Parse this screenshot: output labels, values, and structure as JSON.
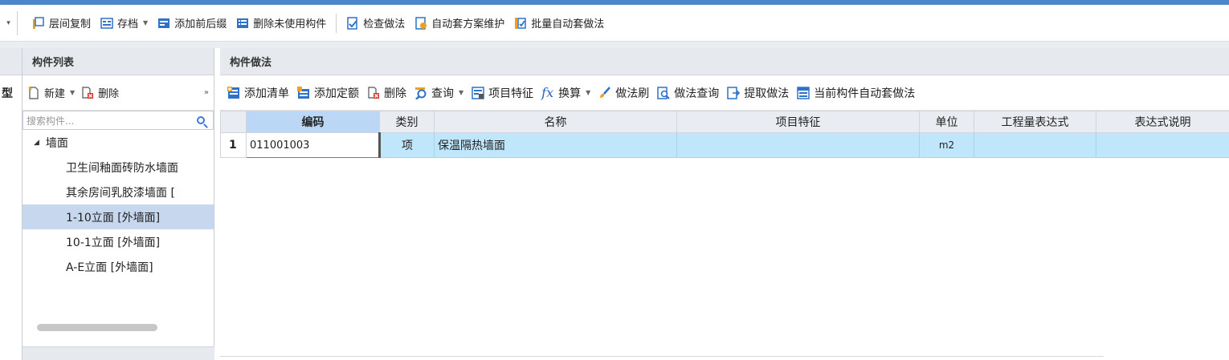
{
  "toolbar": {
    "items": [
      {
        "label": "层间复制",
        "icon": "copy-layers-icon",
        "caret": false
      },
      {
        "label": "存档",
        "icon": "save-archive-icon",
        "caret": true
      },
      {
        "label": "添加前后缀",
        "icon": "add-prefix-suffix-icon",
        "caret": false
      },
      {
        "label": "删除未使用构件",
        "icon": "delete-unused-icon",
        "caret": false
      },
      {
        "label": "检查做法",
        "icon": "check-method-icon",
        "caret": false
      },
      {
        "label": "自动套方案维护",
        "icon": "auto-scheme-icon",
        "caret": false
      },
      {
        "label": "批量自动套做法",
        "icon": "batch-auto-icon",
        "caret": false
      }
    ]
  },
  "left_edge": {
    "char": "型"
  },
  "component_list": {
    "title": "构件列表",
    "new_label": "新建",
    "delete_label": "删除",
    "search_placeholder": "搜索构件...",
    "tree": {
      "root_label": "墙面",
      "children": [
        {
          "label": "卫生间釉面砖防水墙面"
        },
        {
          "label": "其余房间乳胶漆墙面 ["
        },
        {
          "label": "1-10立面 [外墙面]",
          "selected": true
        },
        {
          "label": "10-1立面 [外墙面]"
        },
        {
          "label": "A-E立面 [外墙面]"
        }
      ]
    }
  },
  "method_panel": {
    "title": "构件做法",
    "toolbar": {
      "add_list": "添加清单",
      "add_quota": "添加定额",
      "delete": "删除",
      "query": "查询",
      "item_feature": "项目特征",
      "convert": "换算",
      "method_brush": "做法刷",
      "method_query": "做法查询",
      "extract_method": "提取做法",
      "auto_apply": "当前构件自动套做法"
    },
    "table": {
      "columns": [
        "编码",
        "类别",
        "名称",
        "项目特征",
        "单位",
        "工程量表达式",
        "表达式说明"
      ],
      "rows": [
        {
          "index": "1",
          "code": "011001003",
          "type": "项",
          "name": "保温隔热墙面",
          "feature": "",
          "unit": "m2",
          "expression": "",
          "expression_desc": ""
        }
      ]
    }
  }
}
